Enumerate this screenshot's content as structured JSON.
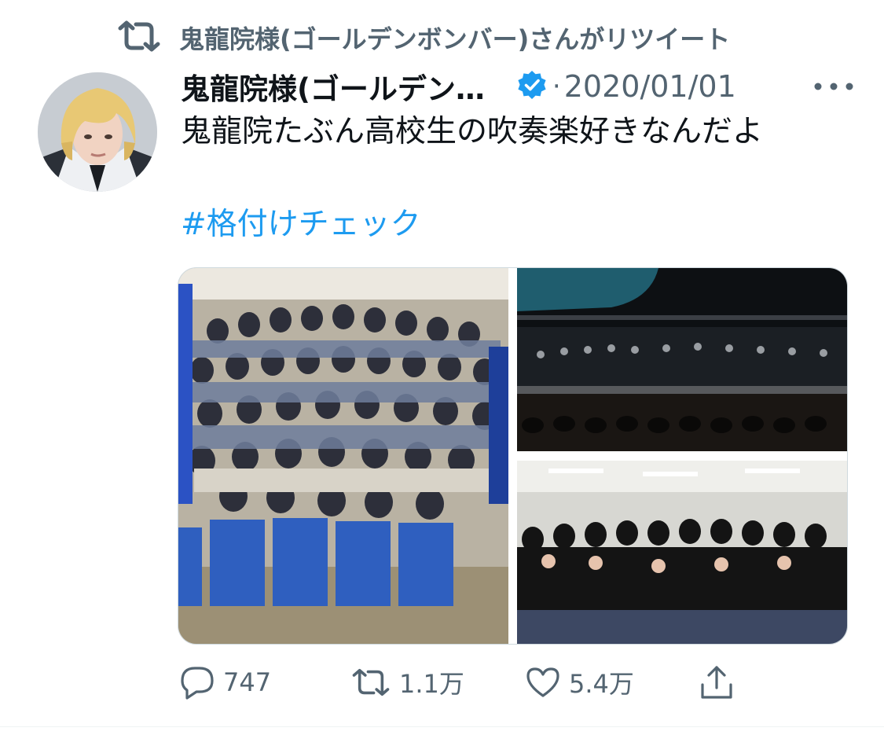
{
  "retweet_banner": {
    "text": "鬼龍院様(ゴールデンボンバー)さんがリツイート",
    "icon": "retweet-icon"
  },
  "author": {
    "display_name": "鬼龍院様(ゴールデン…",
    "verified": true,
    "verified_icon": "verified-badge-icon",
    "avatar_icon": "profile-avatar"
  },
  "tweet": {
    "separator": "·",
    "date": "2020/01/01",
    "text": "鬼龍院たぶん高校生の吹奏楽好きなんだよ",
    "hashtag": "#格付けチェック",
    "more_icon": "more-options-icon"
  },
  "media": {
    "count": 3,
    "photos": [
      {
        "icon": "group-photo-students"
      },
      {
        "icon": "concert-stage-photo"
      },
      {
        "icon": "group-photo-black-clothes"
      }
    ]
  },
  "actions": {
    "reply_count": "747",
    "retweet_count": "1.1万",
    "like_count": "5.4万",
    "reply_icon": "reply-icon",
    "retweet_icon": "retweet-icon",
    "like_icon": "heart-icon",
    "share_icon": "share-icon"
  },
  "colors": {
    "accent": "#1d9bf0",
    "secondary_text": "#536471",
    "primary_text": "#0f1419",
    "border": "#cfd9de"
  }
}
